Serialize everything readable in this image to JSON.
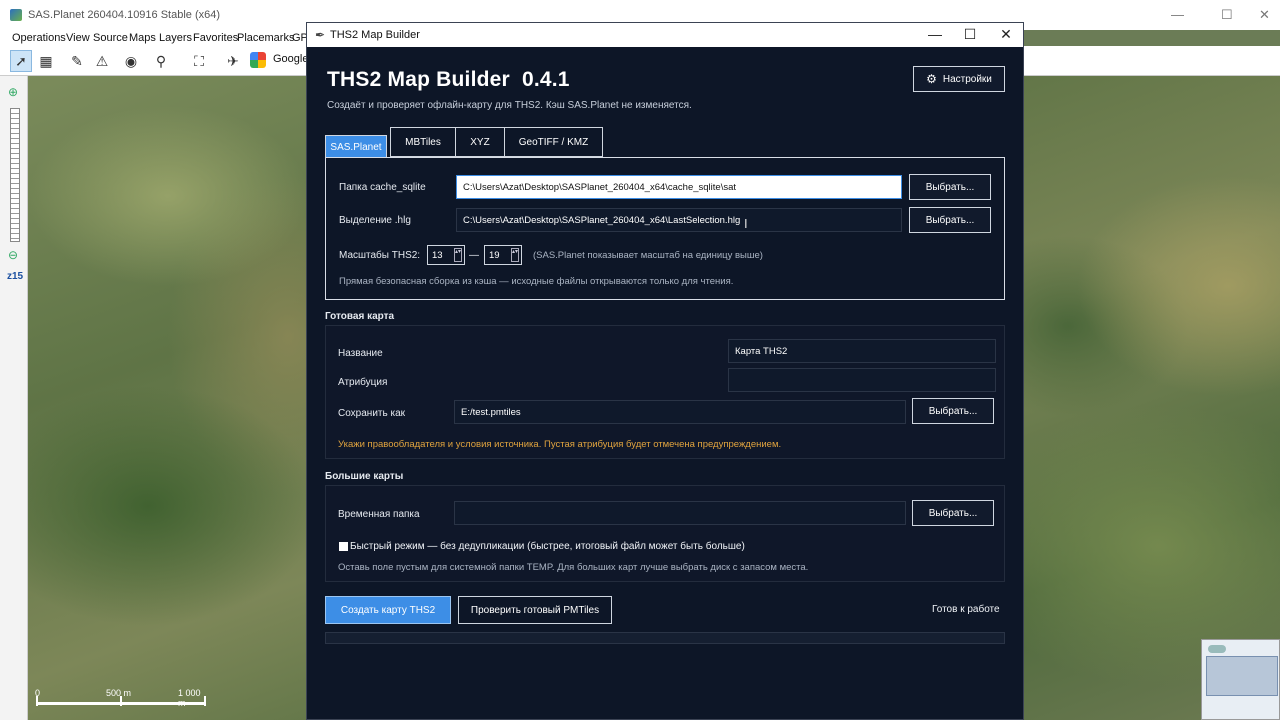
{
  "bg_window": {
    "title": "SAS.Planet 260404.10916 Stable (x64)",
    "controls": [
      "—",
      "☐",
      "✕"
    ],
    "menu": [
      "Operations",
      "View",
      "Source",
      "Maps",
      "Layers",
      "Favorites",
      "Placemarks",
      "GPS"
    ],
    "toolbar_map_label": "Google",
    "zoom_label": "z15",
    "scale_labels": [
      "0",
      "500 m",
      "1 000 m"
    ]
  },
  "dialog": {
    "window_title": "THS2 Map Builder",
    "controls": [
      "—",
      "☐",
      "✕"
    ],
    "app_title": "THS2 Map Builder  0.4.1",
    "subtitle": "Создаёт и проверяет офлайн-карту для THS2. Кэш SAS.Planet не изменяется.",
    "settings_label": "Настройки",
    "tabs": [
      "SAS.Planet",
      "MBTiles",
      "XYZ",
      "GeoTIFF / KMZ"
    ],
    "active_tab": 0,
    "source": {
      "cache_label": "Папка cache_sqlite",
      "cache_value": "C:\\Users\\Azat\\Desktop\\SASPlanet_260404_x64\\cache_sqlite\\sat",
      "selection_label": "Выделение .hlg",
      "selection_value": "C:\\Users\\Azat\\Desktop\\SASPlanet_260404_x64\\LastSelection.hlg",
      "browse_label": "Выбрать...",
      "scales_label": "Масштабы THS2:",
      "scale_min": "13",
      "scale_sep": "—",
      "scale_max": "19",
      "scales_hint": "(SAS.Planet показывает масштаб на единицу выше)",
      "safety_hint": "Прямая безопасная сборка из кэша — исходные файлы открываются только для чтения."
    },
    "output": {
      "section_title": "Готовая карта",
      "name_label": "Название",
      "name_value": "Карта THS2",
      "attribution_label": "Атрибуция",
      "attribution_value": "",
      "save_label": "Сохранить как",
      "save_value": "E:/test.pmtiles",
      "browse_label": "Выбрать...",
      "warning": "Укажи правообладателя и условия источника. Пустая атрибуция будет отмечена предупреждением."
    },
    "large": {
      "section_title": "Большие карты",
      "temp_label": "Временная папка",
      "temp_value": "",
      "browse_label": "Выбрать...",
      "fast_mode_label": "Быстрый режим — без дедупликации (быстрее, итоговый файл может быть больше)",
      "fast_mode_checked": false,
      "hint": "Оставь поле пустым для системной папки TEMP. Для больших карт лучше выбрать диск с запасом места."
    },
    "actions": {
      "create_label": "Создать карту THS2",
      "verify_label": "Проверить готовый PMTiles",
      "status": "Готов к работе",
      "progress_percent": 0
    },
    "colors": {
      "background": "#0d1627",
      "accent": "#3d8ee6",
      "warning": "#e0a33e"
    }
  }
}
